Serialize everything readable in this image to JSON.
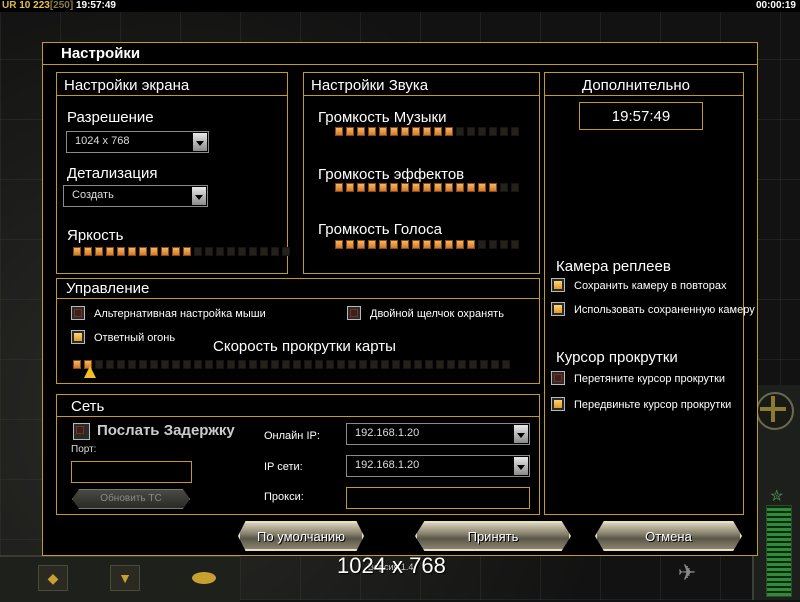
{
  "hud": {
    "player_tag": "UR",
    "level": "10",
    "score": "223",
    "score_max": "[250]",
    "clock": "19:57:49",
    "timer": "00:00:19"
  },
  "dialog": {
    "title": "Настройки"
  },
  "screen": {
    "title": "Настройки экрана",
    "resolution_label": "Разрешение",
    "resolution_value": "1024 x 768",
    "detail_label": "Детализация",
    "detail_value": "Создать",
    "brightness_label": "Яркость",
    "brightness_level": 11,
    "brightness_max": 20
  },
  "sound": {
    "title": "Настройки Звука",
    "music_label": "Громкость Музыки",
    "music_level": 11,
    "music_max": 17,
    "effects_label": "Громкость эффектов",
    "effects_level": 15,
    "effects_max": 17,
    "voice_label": "Громкость Голоса",
    "voice_level": 13,
    "voice_max": 17
  },
  "extra": {
    "title": "Дополнительно",
    "time": "19:57:49",
    "replay_camera_title": "Камера реплеев",
    "save_camera_label": "Сохранить камеру в повторах",
    "save_camera_checked": true,
    "use_saved_camera_label": "Использовать сохраненную камеру",
    "use_saved_camera_checked": true,
    "scroll_cursor_title": "Курсор прокрутки",
    "drag_cursor_label": "Перетяните курсор прокрутки",
    "drag_cursor_checked": false,
    "move_cursor_label": "Передвиньте курсор прокрутки",
    "move_cursor_checked": true
  },
  "controls": {
    "title": "Управление",
    "alt_mouse_label": "Альтернативная настройка мыши",
    "alt_mouse_checked": false,
    "double_click_label": "Двойной щелчок охранять",
    "double_click_checked": false,
    "return_fire_label": "Ответный огонь",
    "return_fire_checked": true,
    "scroll_speed_label": "Скорость прокрутки карты",
    "scroll_speed_level": 2,
    "scroll_speed_max": 40
  },
  "network": {
    "title": "Сеть",
    "send_delay_label": "Послать Задержку",
    "send_delay_checked": false,
    "port_label": "Порт:",
    "port_value": "",
    "update_tcp_label": "Обновить ТС",
    "online_ip_label": "Онлайн IP:",
    "online_ip_value": "192.168.1.20",
    "lan_ip_label": "IP сети:",
    "lan_ip_value": "192.168.1.20",
    "proxy_label": "Прокси:",
    "proxy_value": ""
  },
  "buttons": {
    "defaults": "По умолчанию",
    "accept": "Принять",
    "cancel": "Отмена"
  },
  "overlay": {
    "resolution": "1024 x 768",
    "version": "Версия 1.4"
  },
  "colors": {
    "frame_gold": "#c49b1f",
    "slider_on": "#f0a050",
    "slider_off": "#24211b"
  }
}
